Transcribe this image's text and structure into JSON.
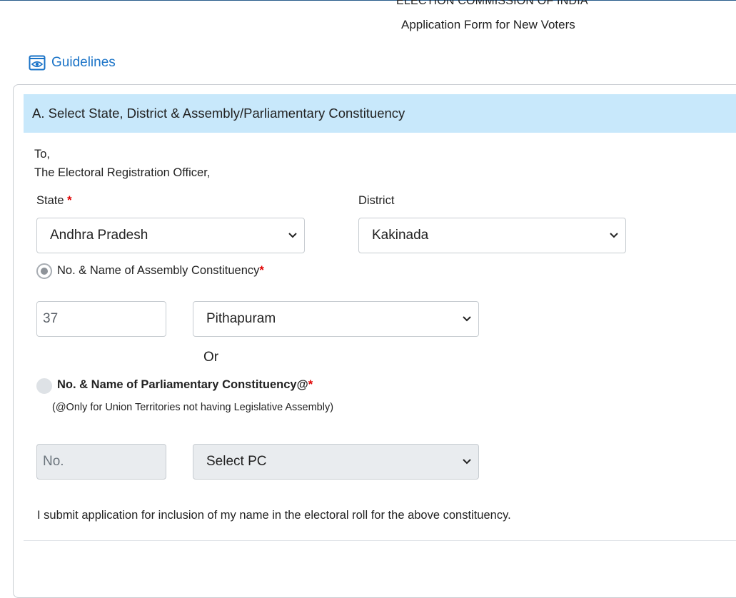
{
  "header": {
    "organization": "ELECTION COMMISSION OF INDIA",
    "form_title": "Application Form for New Voters"
  },
  "guidelines": {
    "label": "Guidelines",
    "icon": "eye-icon",
    "color": "#1a73c7"
  },
  "section_a": {
    "title": "A. Select State, District & Assembly/Parliamentary Constituency",
    "header_bg": "#c8e8fb",
    "to_line": "To,",
    "officer_line": "The Electoral Registration Officer,",
    "state": {
      "label": "State",
      "required_mark": "*",
      "selected": "Andhra Pradesh"
    },
    "district": {
      "label": "District",
      "selected": "Kakinada"
    },
    "assembly": {
      "label": "No. & Name of Assembly Constituency",
      "required_mark": "*",
      "selected": true,
      "number_value": "37",
      "name_selected": "Pithapuram"
    },
    "or_text": "Or",
    "parliamentary": {
      "label": "No. & Name of Parliamentary Constituency@",
      "required_mark": "*",
      "selected": false,
      "note": "(@Only for Union Territories not having Legislative Assembly)",
      "number_placeholder": "No.",
      "name_placeholder": "Select PC"
    },
    "declaration": "I submit application for inclusion of my name in the electoral roll for the above constituency."
  }
}
